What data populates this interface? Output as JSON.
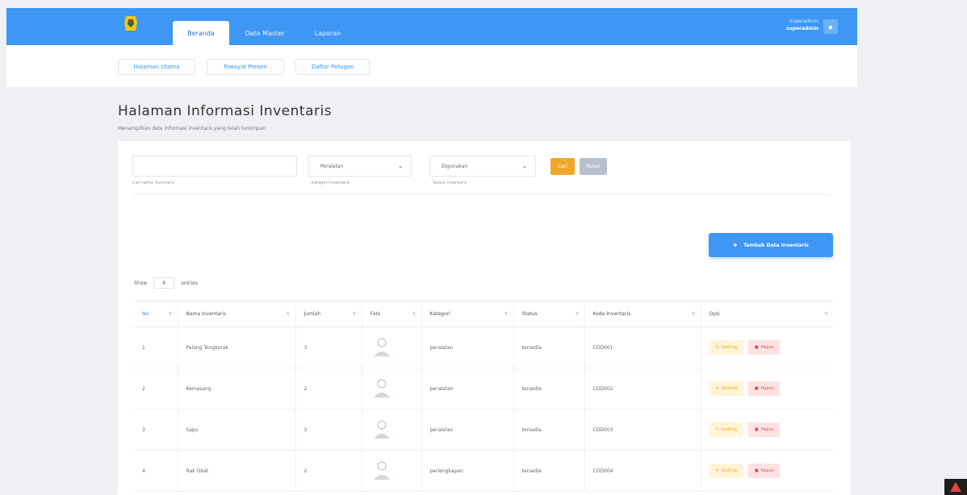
{
  "header": {
    "tabs": [
      {
        "label": "Beranda",
        "active": true
      },
      {
        "label": "Data Master",
        "active": false
      },
      {
        "label": "Laporan",
        "active": false
      }
    ],
    "user_role": "Superadmin",
    "user_name": "superadmin"
  },
  "subnav": {
    "items": [
      "Halaman Utama",
      "Riwayat Presen",
      "Daftar Petugas"
    ]
  },
  "page": {
    "title": "Halaman Informasi Inventaris",
    "subtitle": "Menampilkan data informasi inventaris yang telah tersimpan"
  },
  "filters": {
    "search_label": "Cari nama inventaris",
    "search_value": "",
    "kategori_value": "Peralatan",
    "kategori_label": "Kategori inventaris",
    "status_value": "Digunakan",
    "status_label": "Status inventaris",
    "cari_button": "Cari",
    "reset_button": "Reset"
  },
  "actions": {
    "add_button": "Tambah Data Inventaris"
  },
  "length": {
    "show": "Show",
    "value": "8",
    "entries": "entries"
  },
  "table": {
    "columns": [
      "No.",
      "Nama Inventaris",
      "Jumlah",
      "Foto",
      "Kategori",
      "Status",
      "Kode Inventaris",
      "Opsi"
    ],
    "rows": [
      {
        "no": "1",
        "nama": "Palang Tengkorak",
        "jumlah": "3",
        "kategori": "peralatan",
        "status": "tersedia",
        "kode": "COD001"
      },
      {
        "no": "2",
        "nama": "Kemasang",
        "jumlah": "2",
        "kategori": "peralatan",
        "status": "tersedia",
        "kode": "COD002"
      },
      {
        "no": "3",
        "nama": "Sapu",
        "jumlah": "3",
        "kategori": "peralatan",
        "status": "tersedia",
        "kode": "COD003"
      },
      {
        "no": "4",
        "nama": "Rak Obat",
        "jumlah": "2",
        "kategori": "perlengkapan",
        "status": "tersedia",
        "kode": "COD004"
      }
    ],
    "edit_label": "Sunting",
    "delete_label": "Hapus"
  },
  "colors": {
    "primary": "#3e97f4",
    "warning": "#f3a72a",
    "danger": "#e04949"
  }
}
